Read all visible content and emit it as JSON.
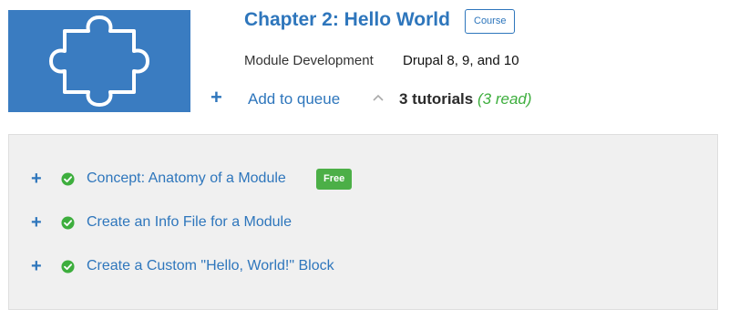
{
  "chapter": {
    "title": "Chapter 2: Hello World",
    "badge": "Course",
    "topic": "Module Development",
    "versions": "Drupal 8, 9, and 10",
    "image_icon": "puzzle-piece-icon",
    "image_color": "#3a7cc1"
  },
  "queue": {
    "plus_symbol": "+",
    "label": "Add to queue"
  },
  "summary": {
    "tutorial_count": "3 tutorials",
    "read_count": "(3 read)"
  },
  "tutorials": [
    {
      "plus": "+",
      "title": "Concept: Anatomy of a Module",
      "badge": "Free",
      "status_icon": "check-circle-icon"
    },
    {
      "plus": "+",
      "title": "Create an Info File for a Module",
      "status_icon": "check-circle-icon"
    },
    {
      "plus": "+",
      "title": "Create a Custom \"Hello, World!\" Block",
      "status_icon": "check-circle-icon"
    }
  ],
  "colors": {
    "accent": "#2e76bc",
    "success": "#3dae3d",
    "panel": "#f0f0f0"
  }
}
